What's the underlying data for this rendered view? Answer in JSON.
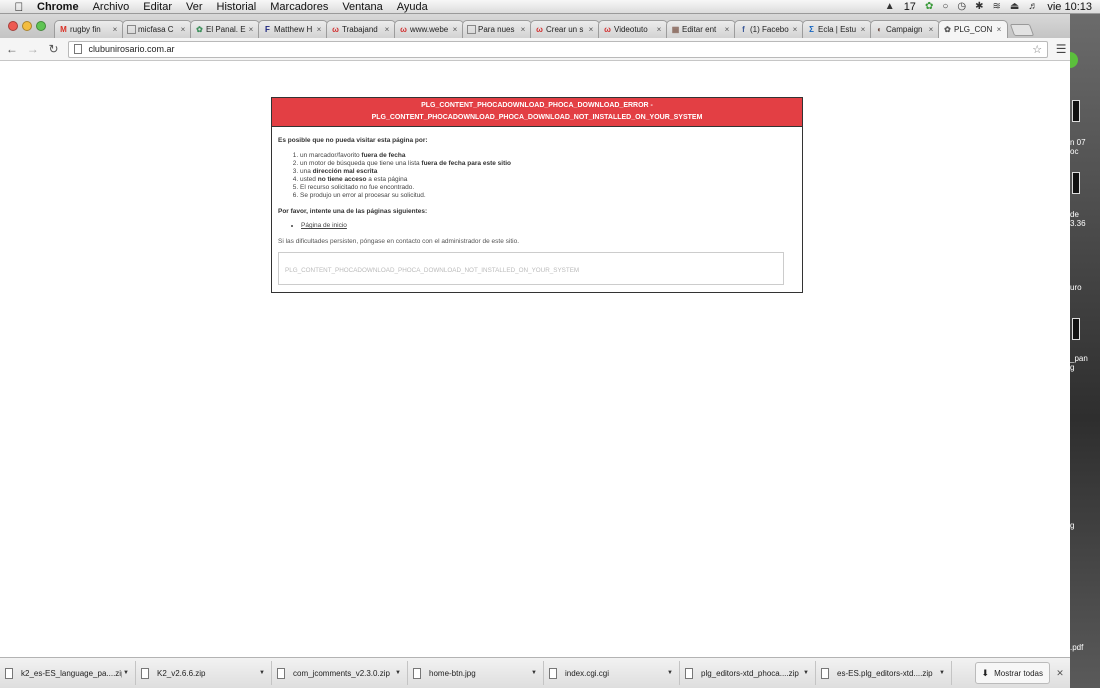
{
  "menubar": {
    "apple": "",
    "items": [
      "Chrome",
      "Archivo",
      "Editar",
      "Ver",
      "Historial",
      "Marcadores",
      "Ventana",
      "Ayuda"
    ],
    "status": {
      "counter": "17",
      "clock": "vie 10:13"
    }
  },
  "tabs": [
    {
      "title": "rugby fin",
      "fav": "M",
      "favcolor": "#d93025"
    },
    {
      "title": "micfasa C",
      "fav": "",
      "favcolor": "#666666"
    },
    {
      "title": "El Panal. E",
      "fav": "✿",
      "favcolor": "#3b8f5a"
    },
    {
      "title": "Matthew H",
      "fav": "F",
      "favcolor": "#1a237e"
    },
    {
      "title": "Trabajand",
      "fav": "ω",
      "favcolor": "#d32f2f"
    },
    {
      "title": "www.webe",
      "fav": "ω",
      "favcolor": "#d32f2f"
    },
    {
      "title": "Para nues",
      "fav": "",
      "favcolor": "#666666"
    },
    {
      "title": "Crear un s",
      "fav": "ω",
      "favcolor": "#d32f2f"
    },
    {
      "title": "Videotuto",
      "fav": "ω",
      "favcolor": "#d32f2f"
    },
    {
      "title": "Editar ent",
      "fav": "▦",
      "favcolor": "#8d6e63"
    },
    {
      "title": "(1) Facebo",
      "fav": "f",
      "favcolor": "#3b5998"
    },
    {
      "title": "Ecla | Estu",
      "fav": "Σ",
      "favcolor": "#1565c0"
    },
    {
      "title": "Campaign",
      "fav": "◐",
      "favcolor": "#6d4c41"
    },
    {
      "title": "PLG_CON",
      "fav": "✿",
      "favcolor": "#555555"
    }
  ],
  "toolbar": {
    "url": "clubunirosario.com.ar"
  },
  "error": {
    "heading1": "PLG_CONTENT_PHOCADOWNLOAD_PHOCA_DOWNLOAD_ERROR -",
    "heading2": "PLG_CONTENT_PHOCADOWNLOAD_PHOCA_DOWNLOAD_NOT_INSTALLED_ON_YOUR_SYSTEM",
    "intro": "Es posible que no pueda visitar esta página por:",
    "reasons": [
      {
        "pre": "un marcador/favorito ",
        "bold": "fuera de fecha",
        "post": ""
      },
      {
        "pre": "un motor de búsqueda que tiene una lista ",
        "bold": "fuera de fecha para este sitio",
        "post": ""
      },
      {
        "pre": "una ",
        "bold": "dirección mal escrita",
        "post": ""
      },
      {
        "pre": "usted ",
        "bold": "no tiene acceso",
        "post": " a esta página"
      },
      {
        "pre": "El recurso solicitado no fue encontrado.",
        "bold": "",
        "post": ""
      },
      {
        "pre": "Se produjo un error al procesar su solicitud.",
        "bold": "",
        "post": ""
      }
    ],
    "prefer": "Por favor, intente una de las páginas siguientes:",
    "home_link": "Página de inicio",
    "note": "Si las dificultades persisten, póngase en contacto con el administrador de este sitio.",
    "code": "PLG_CONTENT_PHOCADOWNLOAD_PHOCA_DOWNLOAD_NOT_INSTALLED_ON_YOUR_SYSTEM"
  },
  "downloads": {
    "items": [
      "k2_es-ES_language_pa....zip",
      "K2_v2.6.6.zip",
      "com_jcomments_v2.3.0.zip",
      "home-btn.jpg",
      "index.cgi.cgi",
      "plg_editors-xtd_phoca....zip",
      "es-ES.plg_editors-xtd....zip"
    ],
    "show_all": "Mostrar todas"
  },
  "desktop_labels": [
    "n 07",
    "oc",
    "de",
    "3.36",
    "uro",
    "_pan",
    "g",
    "g",
    ".pdf"
  ]
}
